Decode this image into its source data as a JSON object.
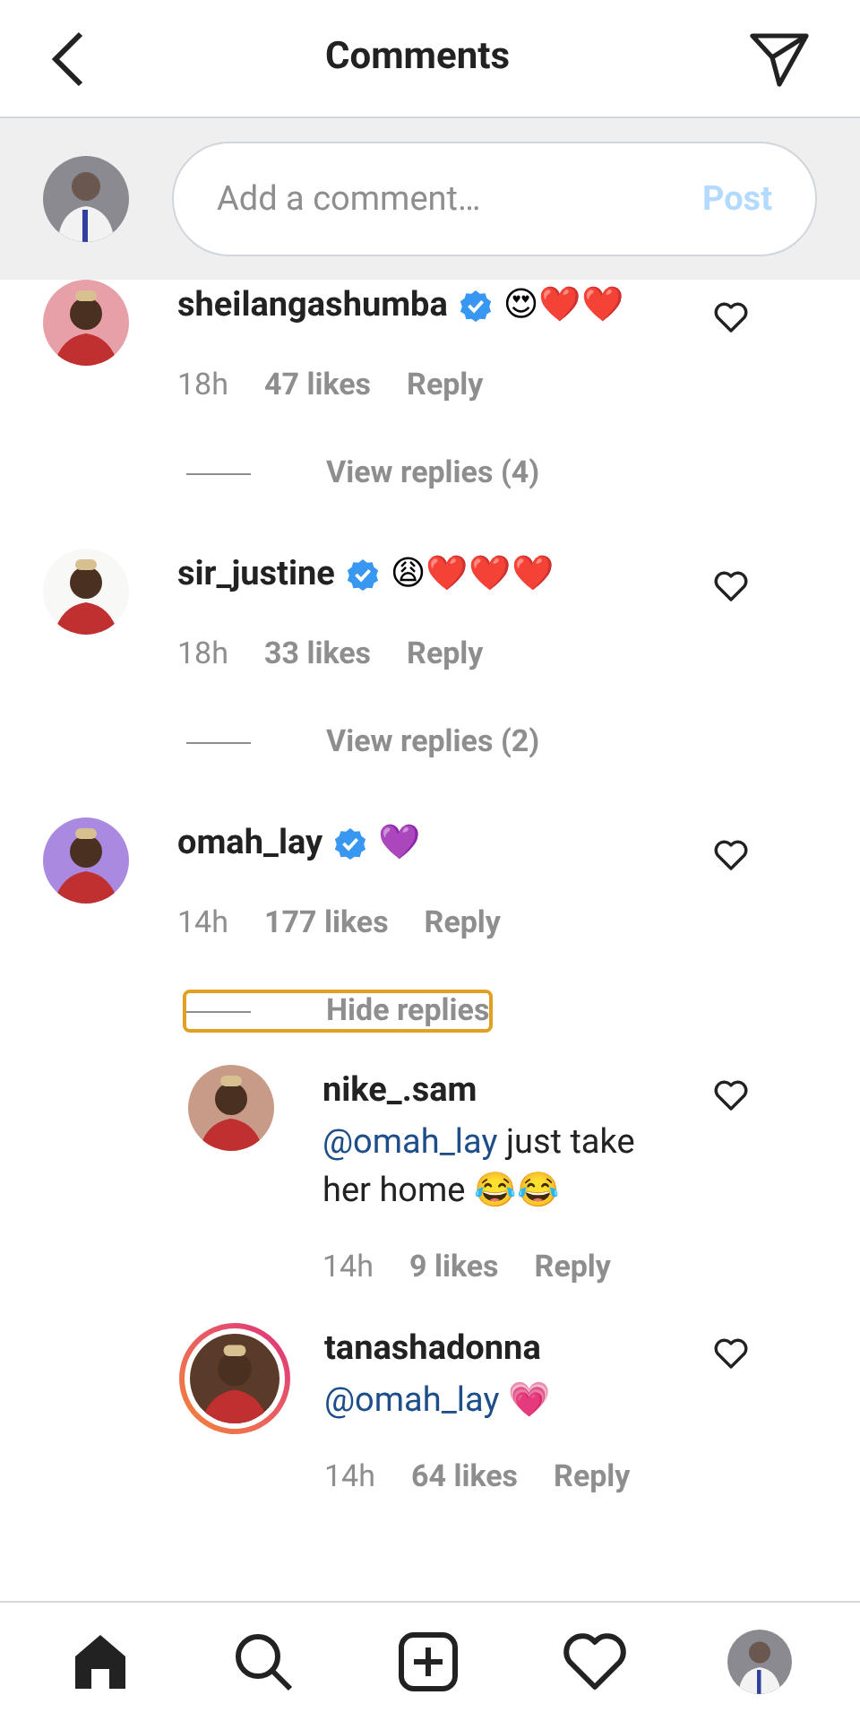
{
  "header": {
    "title": "Comments"
  },
  "composer": {
    "placeholder": "Add a comment…",
    "post_label": "Post"
  },
  "comments": [
    {
      "username": "sheilangashumba",
      "verified": true,
      "text": "😍❤️❤️",
      "time": "18h",
      "likes": "47 likes",
      "reply": "Reply",
      "toggle": {
        "label": "View replies (4)",
        "focused": false
      }
    },
    {
      "username": "sir_justine",
      "verified": true,
      "text": "😩❤️❤️❤️",
      "time": "18h",
      "likes": "33 likes",
      "reply": "Reply",
      "toggle": {
        "label": "View replies (2)",
        "focused": false
      }
    },
    {
      "username": "omah_lay",
      "verified": true,
      "text": "💜",
      "time": "14h",
      "likes": "177 likes",
      "reply": "Reply",
      "toggle": {
        "label": "Hide replies",
        "focused": true
      },
      "replies": [
        {
          "username": "nike_.sam",
          "mention": "@omah_lay",
          "text": "just take her home 😂😂",
          "time": "14h",
          "likes": "9 likes",
          "reply": "Reply",
          "story_ring": false
        },
        {
          "username": "tanashadonna",
          "mention": "@omah_lay",
          "text": "💗",
          "time": "14h",
          "likes": "64 likes",
          "reply": "Reply",
          "story_ring": true
        }
      ]
    }
  ]
}
